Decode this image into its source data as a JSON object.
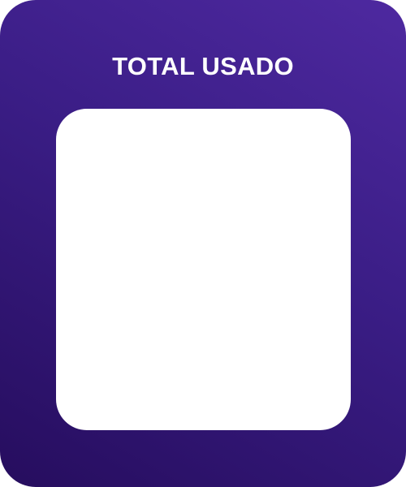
{
  "card": {
    "title": "TOTAL USADO"
  },
  "colors": {
    "gradient_top": "#4e29a0",
    "gradient_bottom": "#260d5e",
    "title_text": "#ffffff",
    "panel_background": "#ffffff"
  }
}
